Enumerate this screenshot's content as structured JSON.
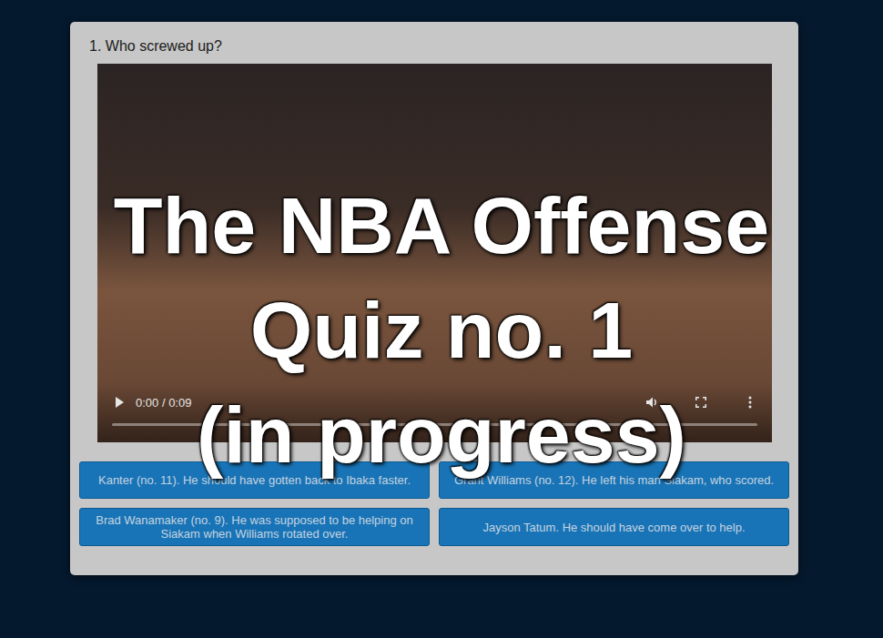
{
  "quiz": {
    "question": "1. Who screwed up?",
    "video": {
      "time": "0:00 / 0:09",
      "playing": false,
      "level": 0
    },
    "answers": [
      {
        "text": "Kanter (no. 11). He should have gotten back to Ibaka faster."
      },
      {
        "text": "Grant Williams (no. 12). He left his man Siakam, who scored."
      },
      {
        "text": "Brad Wanamaker (no. 9). He was supposed to be helping on Siakam when Williams rotated over."
      },
      {
        "text": "Jayson Tatum. He should have come over to help."
      }
    ]
  },
  "overlay": {
    "lines": [
      "The NBA Offense",
      "Quiz no. 1",
      "(in progress)"
    ]
  }
}
